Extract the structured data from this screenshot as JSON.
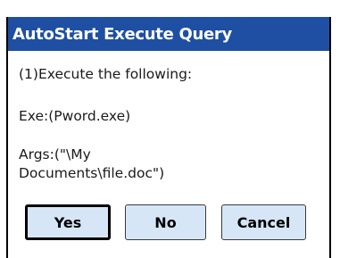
{
  "window": {
    "title": "AutoStart Execute Query"
  },
  "message": {
    "line1": "(1)Execute the following:",
    "exe": "Exe:(Pword.exe)",
    "args_line1": "Args:(\"\\My",
    "args_line2": "Documents\\file.doc\")"
  },
  "buttons": {
    "yes": "Yes",
    "no": "No",
    "cancel": "Cancel"
  },
  "colors": {
    "titlebar": "#1e4fa3",
    "button_face": "#d6e6f7"
  }
}
